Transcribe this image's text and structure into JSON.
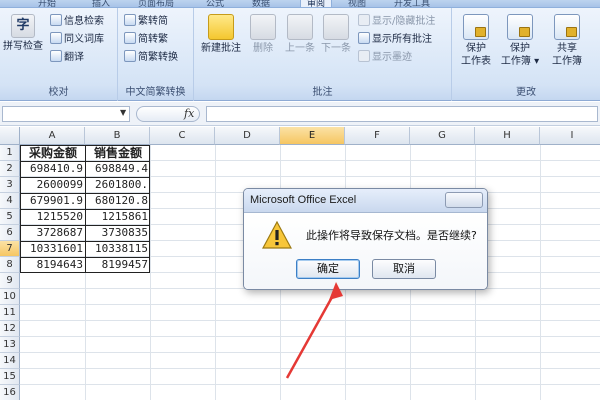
{
  "tabs": [
    "开始",
    "插入",
    "页面布局",
    "公式",
    "数据",
    "审阅",
    "视图",
    "开发工具"
  ],
  "tabs_active": "审阅",
  "ribbon": {
    "proofing": {
      "big": "拼写检查",
      "items": [
        "信息检索",
        "同义词库",
        "翻译"
      ],
      "label": "校对"
    },
    "chinese": {
      "items": [
        "繁转简",
        "简转繁",
        "简繁转换"
      ],
      "label": "中文简繁转换"
    },
    "comments": {
      "new_comment": "新建批注",
      "delete": "删除",
      "previous": "上一条",
      "next": "下一条",
      "show_hide": "显示/隐藏批注",
      "show_all": "显示所有批注",
      "show_ink": "显示墨迹",
      "label": "批注"
    },
    "changes": {
      "protect_sheet": [
        "保护",
        "工作表"
      ],
      "protect_workbook": [
        "保护",
        "工作簿"
      ],
      "share_workbook": [
        "共享",
        "工作簿"
      ],
      "label": "更改"
    }
  },
  "formula_bar": {
    "fx": "fx"
  },
  "columns": [
    "A",
    "B",
    "C",
    "D",
    "E",
    "F",
    "G",
    "H",
    "I"
  ],
  "selected_column": "E",
  "rows": [
    "1",
    "2",
    "3",
    "4",
    "5",
    "6",
    "7",
    "8",
    "9",
    "10",
    "11",
    "12",
    "13",
    "14",
    "15",
    "16"
  ],
  "selected_row": "7",
  "table": {
    "headers": [
      "采购金额",
      "销售金额"
    ],
    "data": [
      [
        "698410.9",
        "698849.4"
      ],
      [
        "2600099",
        "2601800."
      ],
      [
        "679901.9",
        "680120.8"
      ],
      [
        "1215520",
        "1215861"
      ],
      [
        "3728687",
        "3730835"
      ],
      [
        "10331601",
        "10338115"
      ],
      [
        "8194643",
        "8199457"
      ]
    ]
  },
  "dialog": {
    "title": "Microsoft Office Excel",
    "message": "此操作将导致保存文档。是否继续?",
    "ok": "确定",
    "cancel": "取消",
    "icon": "warning-icon"
  },
  "colors": {
    "ribbon": "#d8e6f7",
    "selected_header": "#f6c662",
    "annotation_arrow": "#e53935"
  }
}
